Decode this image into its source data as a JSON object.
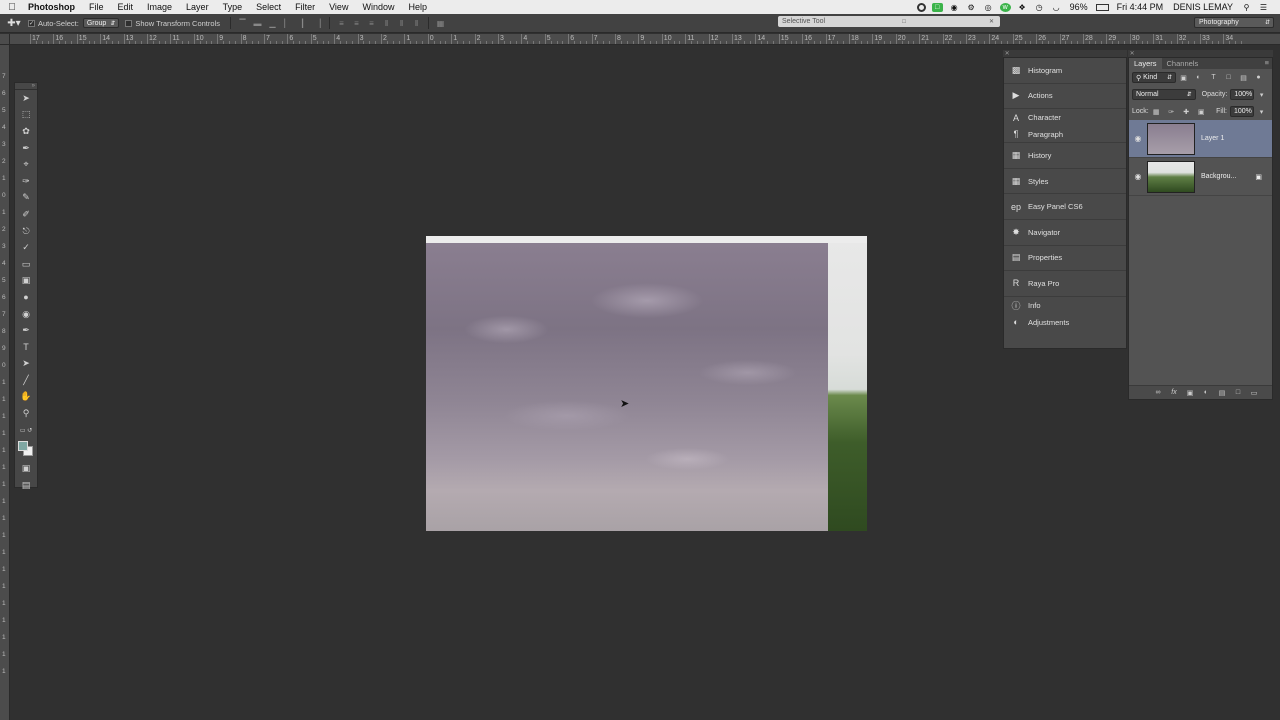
{
  "menubar": {
    "app": "Photoshop",
    "items": [
      "File",
      "Edit",
      "Image",
      "Layer",
      "Type",
      "Select",
      "Filter",
      "View",
      "Window",
      "Help"
    ],
    "battery": "96%",
    "clock": "Fri 4:44 PM",
    "user": "DENIS LEMAY"
  },
  "options": {
    "auto_select_label": "Auto-Select:",
    "auto_select_value": "Group",
    "transform_label": "Show Transform Controls",
    "tooltip": "Selective Tool",
    "workspace": "Photography"
  },
  "rulers": {
    "top": [
      "17",
      "16",
      "15",
      "14",
      "13",
      "12",
      "11",
      "10",
      "9",
      "8",
      "7",
      "6",
      "5",
      "4",
      "3",
      "2",
      "1",
      "0",
      "1",
      "2",
      "3",
      "4",
      "5",
      "6",
      "7",
      "8",
      "9",
      "10",
      "11",
      "12",
      "13",
      "14",
      "15",
      "16",
      "17",
      "18",
      "19",
      "20",
      "21",
      "22",
      "23",
      "24",
      "25",
      "26",
      "27",
      "28",
      "29",
      "30",
      "31",
      "32",
      "33",
      "34"
    ],
    "left": [
      "7",
      "6",
      "5",
      "4",
      "3",
      "2",
      "1",
      "0",
      "1",
      "2",
      "3",
      "4",
      "5",
      "6",
      "7",
      "8",
      "9",
      "0",
      "1",
      "1",
      "1",
      "1",
      "1",
      "1",
      "1",
      "1",
      "1",
      "1",
      "1",
      "1",
      "1",
      "1",
      "1",
      "1",
      "1",
      "1"
    ]
  },
  "dock": {
    "items": [
      "Histogram",
      "Actions",
      "Character",
      "Paragraph",
      "History",
      "Styles",
      "Easy Panel CS6",
      "Navigator",
      "Properties",
      "Raya Pro",
      "Info",
      "Adjustments"
    ]
  },
  "layers": {
    "tab_layers": "Layers",
    "tab_channels": "Channels",
    "filter": "Kind",
    "blend_mode": "Normal",
    "opacity_label": "Opacity:",
    "opacity": "100%",
    "lock_label": "Lock:",
    "fill_label": "Fill:",
    "fill": "100%",
    "items": [
      {
        "name": "Layer 1",
        "selected": true
      },
      {
        "name": "Backgrou...",
        "selected": false
      }
    ]
  }
}
